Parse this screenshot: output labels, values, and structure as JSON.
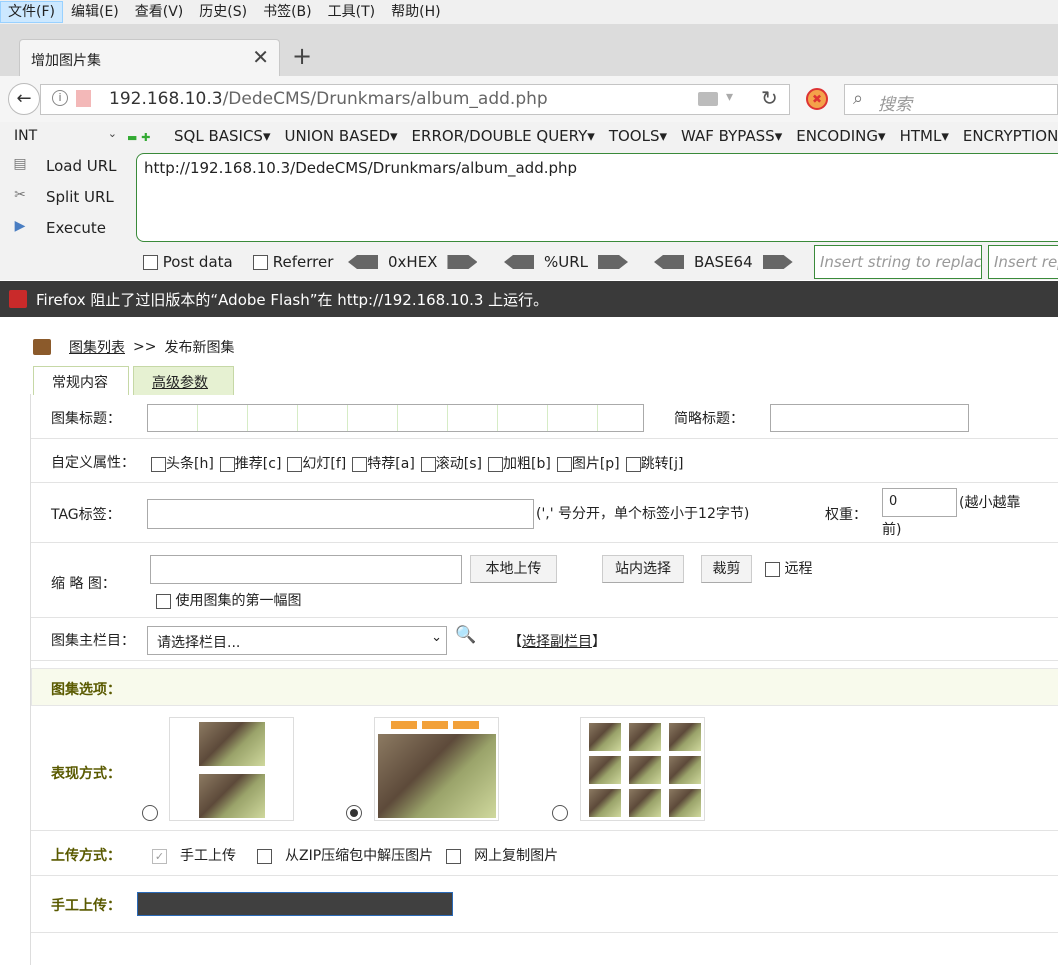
{
  "menubar": [
    "文件(F)",
    "编辑(E)",
    "查看(V)",
    "历史(S)",
    "书签(B)",
    "工具(T)",
    "帮助(H)"
  ],
  "tab": {
    "title": "增加图片集",
    "close": "✕",
    "new": "+"
  },
  "nav": {
    "url_host": "192.168.10.3",
    "url_path": "/DedeCMS/Drunkmars/album_add.php",
    "search_placeholder": "搜索"
  },
  "hackbar": {
    "int_value": "INT",
    "menu": [
      "SQL BASICS",
      "UNION BASED",
      "ERROR/DOUBLE QUERY",
      "TOOLS",
      "WAF BYPASS",
      "ENCODING",
      "HTML",
      "ENCRYPTION"
    ],
    "load_url": "Load URL",
    "split_url": "Split URL",
    "execute": "Execute",
    "url_text": "http://192.168.10.3/DedeCMS/Drunkmars/album_add.php",
    "post_data": "Post data",
    "referrer": "Referrer",
    "hex": "0xHEX",
    "urlenc": "%URL",
    "base64": "BASE64",
    "insert_replace": "Insert string to replace",
    "insert_rep2": "Insert rep"
  },
  "flash_notice": "Firefox 阻止了过旧版本的“Adobe Flash”在 http://192.168.10.3 上运行。",
  "page": {
    "crumb_link": "图集列表",
    "crumb_sep": ">>",
    "crumb_current": "发布新图集",
    "tabs": [
      "常规内容",
      "高级参数"
    ],
    "title_label": "图集标题：",
    "short_title_label": "简略标题：",
    "attr_label": "自定义属性：",
    "attrs": [
      "头条[h]",
      "推荐[c]",
      "幻灯[f]",
      "特荐[a]",
      "滚动[s]",
      "加粗[b]",
      "图片[p]",
      "跳转[j]"
    ],
    "tag_label": "TAG标签：",
    "tag_hint": "(',' 号分开，单个标签小于12字节)",
    "weight_label": "权重：",
    "weight_value": "0",
    "weight_hint_1": "(越小越靠",
    "weight_hint_2": "前)",
    "thumb_label": "缩 略 图：",
    "upload_btn": "本地上传",
    "site_select_btn": "站内选择",
    "crop_btn": "裁剪",
    "remote": "远程",
    "use_first": "使用图集的第一幅图",
    "main_col_label": "图集主栏目：",
    "main_col_value": "请选择栏目...",
    "sub_col_prefix": "【",
    "sub_col_link": "选择副栏目",
    "sub_col_suffix": "】",
    "options_label": "图集选项：",
    "display_label": "表现方式：",
    "upload_mode_label": "上传方式：",
    "upload_modes": [
      "手工上传",
      "从ZIP压缩包中解压图片",
      "网上复制图片"
    ],
    "manual_upload_label": "手工上传："
  }
}
